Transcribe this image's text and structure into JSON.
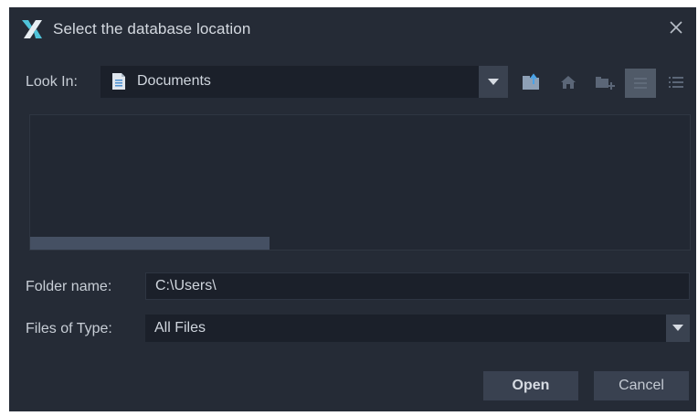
{
  "dialog": {
    "title": "Select the database location",
    "icons": {
      "app": "app-logo-icon",
      "close": "close-icon"
    }
  },
  "look_in": {
    "label": "Look In:",
    "value": "Documents",
    "icon": "document-folder-icon"
  },
  "toolbar": {
    "items": [
      "up-one-level-icon",
      "home-icon",
      "new-folder-icon",
      "list-view-icon",
      "details-view-icon"
    ]
  },
  "folder_name": {
    "label": "Folder name:",
    "value": "C:\\Users\\"
  },
  "files_of_type": {
    "label": "Files of Type:",
    "value": "All Files"
  },
  "buttons": {
    "open": "Open",
    "cancel": "Cancel"
  },
  "colors": {
    "background": "#252b36",
    "field": "#1b202a",
    "button": "#394150",
    "accent": "#4fc3d9"
  }
}
